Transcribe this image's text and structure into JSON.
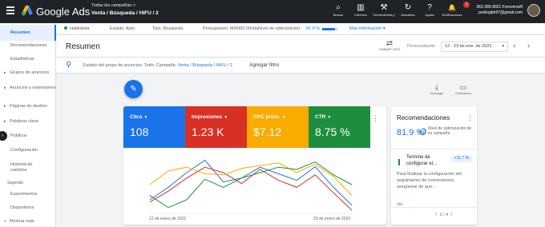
{
  "topbar": {
    "brand": "Google Ads",
    "crumb_top": "Todas las campañas  >",
    "crumb_main": "Venta / Búsqueda / HIFU / 2",
    "tools": [
      {
        "label": "Buscar",
        "icon": "search-icon",
        "glyph": "⌕"
      },
      {
        "label": "Informes",
        "icon": "reports-icon",
        "glyph": "▥"
      },
      {
        "label": "Herramientas y",
        "icon": "tools-icon",
        "glyph": "⚒"
      },
      {
        "label": "Actualizar",
        "icon": "refresh-icon",
        "glyph": "↻"
      },
      {
        "label": "Ayuda",
        "icon": "help-icon",
        "glyph": "?"
      },
      {
        "label": "Notificaciones",
        "icon": "bell-icon",
        "glyph": "🔔"
      }
    ],
    "notification_count": "1",
    "account_id": "363-289-8021 Foreversoft",
    "account_email": "pedrogbtr97@gmail.com"
  },
  "sidebar": {
    "items": [
      {
        "label": "Resumen",
        "active": true,
        "caret": false
      },
      {
        "label": "Recomendaciones",
        "active": false,
        "caret": false
      },
      {
        "label": "Estadísticas",
        "active": false,
        "caret": false
      },
      {
        "label": "Grupos de anuncios",
        "active": false,
        "caret": true
      },
      {
        "label": "Anuncios y extensiones",
        "active": false,
        "caret": true
      },
      {
        "label": "Páginas de destino",
        "active": false,
        "caret": true
      },
      {
        "label": "Palabras clave",
        "active": false,
        "caret": true
      },
      {
        "label": "Públicos",
        "active": false,
        "caret": false
      },
      {
        "label": "Configuración",
        "active": false,
        "caret": false
      },
      {
        "label": "Historial de cambios",
        "active": false,
        "caret": false
      }
    ],
    "group_label": "Sugerido",
    "suggested": [
      "Experimentos",
      "Dispositivos"
    ],
    "more": "Mostrar más"
  },
  "status": {
    "state": "Habilitada",
    "status_label": "Estado: Apto",
    "type_label": "Tipo: Búsqueda",
    "budget_label": "Presupuesto: MXN60.00/día",
    "opt_label": "Nivel de optimización:",
    "opt_value": "81.9 %",
    "opt_fraction": 0.819,
    "more_info": "Más información"
  },
  "header": {
    "title": "Resumen",
    "view_label": "CAMBIAR VISTA",
    "personalizado": "Personalizado",
    "date_range": "12 - 23 de ene. de 2022"
  },
  "filter": {
    "text": "Estado del grupo de anuncios: Todo; Campaña: ",
    "campaign": "Venta / Búsqueda / HIFU / 2",
    "add": "Agregar filtro"
  },
  "actions": {
    "download": "Descargar",
    "comments": "Comentarios"
  },
  "kpis": [
    {
      "name": "Clics",
      "value": "108",
      "color": "#1a73e8"
    },
    {
      "name": "Impresiones",
      "value": "1.23 K",
      "color": "#d93025"
    },
    {
      "name": "CPC prom.",
      "value": "$7.12",
      "color": "#f9ab00"
    },
    {
      "name": "CTR",
      "value": "8.75 %",
      "color": "#1e8e3e"
    }
  ],
  "chart_data": {
    "type": "line",
    "x_start_label": "12 de enero de 2022",
    "x_end_label": "23 de enero de 2022",
    "x": [
      "12 ene",
      "13 ene",
      "14 ene",
      "15 ene",
      "16 ene",
      "17 ene",
      "18 ene",
      "19 ene",
      "20 ene",
      "21 ene",
      "22 ene",
      "23 ene"
    ],
    "series": [
      {
        "name": "Clics",
        "color": "#1a73e8",
        "values": [
          0.22,
          0.45,
          0.72,
          0.95,
          0.55,
          0.62,
          0.82,
          0.7,
          0.58,
          0.83,
          0.45,
          0.12
        ]
      },
      {
        "name": "Impresiones",
        "color": "#d93025",
        "values": [
          0.18,
          0.38,
          0.62,
          0.82,
          0.72,
          0.52,
          0.78,
          0.58,
          0.45,
          0.68,
          0.35,
          0.03
        ]
      },
      {
        "name": "CPC prom.",
        "color": "#f9ab00",
        "values": [
          0.5,
          0.75,
          0.82,
          0.7,
          0.68,
          0.8,
          0.85,
          0.9,
          0.72,
          0.88,
          0.65,
          0.3
        ]
      },
      {
        "name": "CTR",
        "color": "#1e8e3e",
        "values": [
          0.3,
          0.08,
          0.22,
          0.6,
          0.45,
          0.62,
          0.72,
          0.82,
          0.78,
          0.92,
          0.68,
          0.5
        ]
      }
    ]
  },
  "recommendations": {
    "title": "Recomendaciones",
    "score": "81.9 %",
    "score_label": "Nivel de optimización de su campaña",
    "item_title": "Termine de configurar el...",
    "item_chip": "+11.7 %",
    "item_desc": "Para finalizar la configuración del seguimiento de conversiones, asegúrese de que...",
    "link": "Ver",
    "pager": "1 / 4"
  }
}
